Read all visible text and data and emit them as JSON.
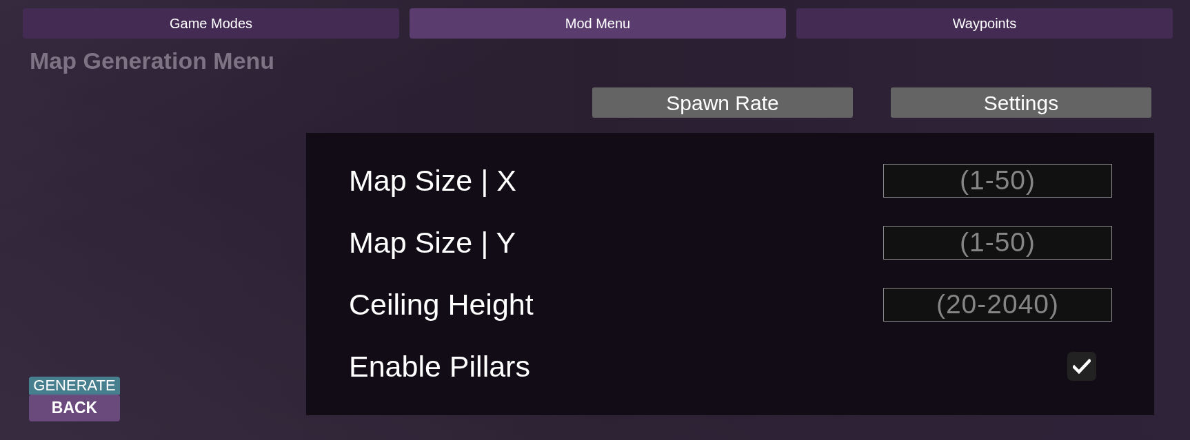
{
  "tabs": [
    {
      "label": "Game Modes",
      "selected": false
    },
    {
      "label": "Mod Menu",
      "selected": true
    },
    {
      "label": "Waypoints",
      "selected": false
    }
  ],
  "title": "Map Generation Menu",
  "section_buttons": [
    "Spawn Rate",
    "Settings"
  ],
  "settings": [
    {
      "kind": "input",
      "label": "Map Size | X",
      "placeholder": "(1-50)"
    },
    {
      "kind": "input",
      "label": "Map Size | Y",
      "placeholder": "(1-50)"
    },
    {
      "kind": "input",
      "label": "Ceiling Height",
      "placeholder": "(20-2040)"
    },
    {
      "kind": "checkbox",
      "label": "Enable Pillars",
      "checked": true
    }
  ],
  "generate_button": {
    "label": "GENERATE"
  },
  "back_button": {
    "label": "BACK"
  }
}
